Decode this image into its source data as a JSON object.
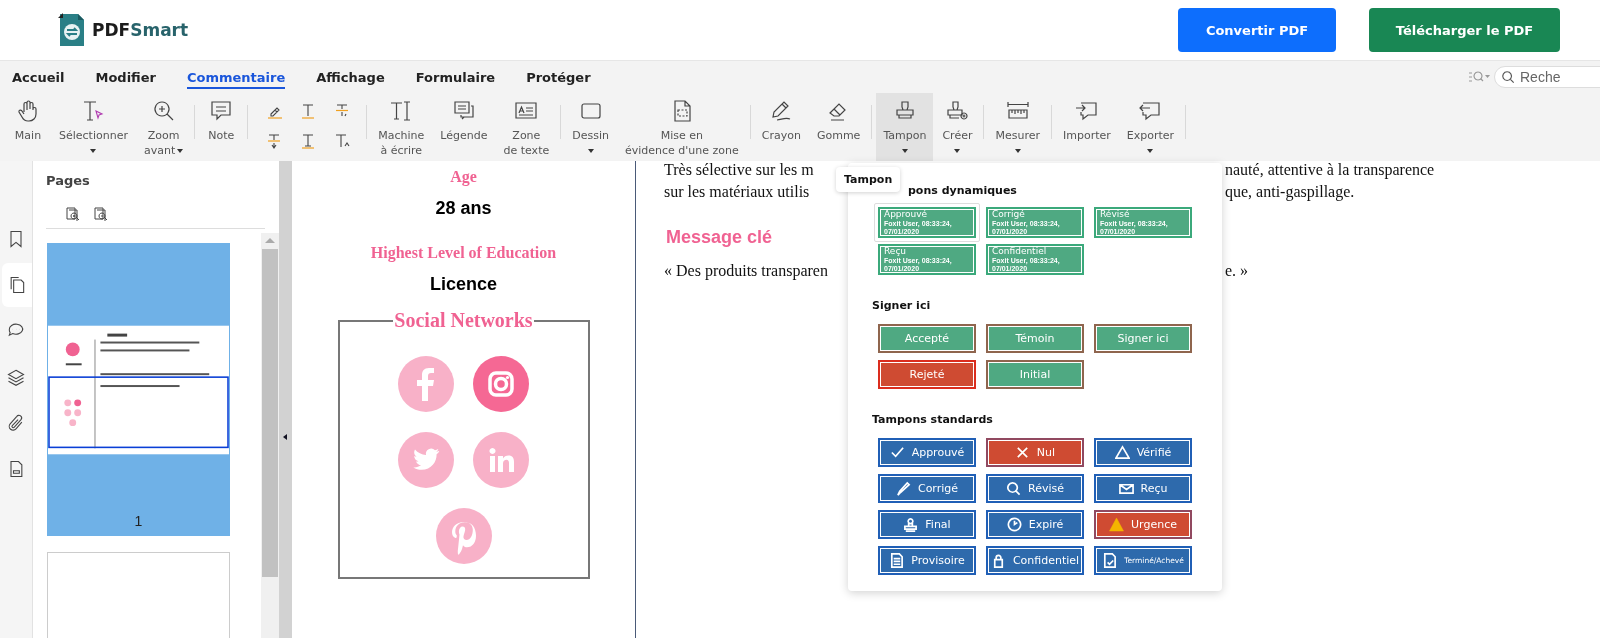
{
  "header": {
    "brand": [
      "PDF",
      "Smart"
    ],
    "buttons": [
      {
        "label": "Convertir PDF",
        "kind": "primary"
      },
      {
        "label": "Télécharger le PDF",
        "kind": "success"
      }
    ]
  },
  "menu_tabs": [
    {
      "label": "Accueil",
      "selected": false
    },
    {
      "label": "Modifier",
      "selected": false
    },
    {
      "label": "Commentaire",
      "selected": true
    },
    {
      "label": "Affichage",
      "selected": false
    },
    {
      "label": "Formulaire",
      "selected": false
    },
    {
      "label": "Protéger",
      "selected": false
    }
  ],
  "search": {
    "placeholder": "Reche"
  },
  "toolbar": {
    "groups": [
      {
        "kind": "tools",
        "tools": [
          {
            "lines": [
              "Main"
            ],
            "dropdown": false,
            "selected": false
          },
          {
            "lines": [
              "Sélectionner"
            ],
            "dropdown": true,
            "selected": false
          },
          {
            "lines": [
              "Zoom",
              "avant"
            ],
            "dropdown": true,
            "selected": false
          }
        ]
      },
      {
        "kind": "tools",
        "tools": [
          {
            "lines": [
              "Note"
            ],
            "dropdown": false,
            "selected": false
          }
        ]
      },
      {
        "kind": "markup"
      },
      {
        "kind": "tools",
        "tools": [
          {
            "lines": [
              "Machine",
              "à écrire"
            ],
            "dropdown": false,
            "selected": false
          },
          {
            "lines": [
              "Légende"
            ],
            "dropdown": false,
            "selected": false
          },
          {
            "lines": [
              "Zone",
              "de texte"
            ],
            "dropdown": false,
            "selected": false
          }
        ]
      },
      {
        "kind": "tools",
        "tools": [
          {
            "lines": [
              "Dessin"
            ],
            "dropdown": true,
            "selected": false
          },
          {
            "lines": [
              "Mise en",
              "évidence d'une zone"
            ],
            "dropdown": false,
            "selected": false
          }
        ]
      },
      {
        "kind": "tools",
        "tools": [
          {
            "lines": [
              "Crayon"
            ],
            "dropdown": false,
            "selected": false
          },
          {
            "lines": [
              "Gomme"
            ],
            "dropdown": false,
            "selected": false
          }
        ]
      },
      {
        "kind": "tools",
        "tools": [
          {
            "lines": [
              "Tampon"
            ],
            "dropdown": true,
            "selected": true
          },
          {
            "lines": [
              "Créer"
            ],
            "dropdown": true,
            "selected": false
          }
        ]
      },
      {
        "kind": "tools",
        "tools": [
          {
            "lines": [
              "Mesurer"
            ],
            "dropdown": true,
            "selected": false
          }
        ]
      },
      {
        "kind": "tools",
        "tools": [
          {
            "lines": [
              "Importer"
            ],
            "dropdown": false,
            "selected": false
          },
          {
            "lines": [
              "Exporter"
            ],
            "dropdown": true,
            "selected": false
          }
        ]
      }
    ]
  },
  "tooltip": "Tampon",
  "rail": [
    {
      "selected": false
    },
    {
      "selected": true
    },
    {
      "selected": false
    },
    {
      "selected": false
    },
    {
      "selected": false
    },
    {
      "selected": false
    }
  ],
  "pages_panel": {
    "title": "Pages",
    "thumbnails": [
      {
        "page_number": "1",
        "selected": true
      },
      {
        "selected": false
      }
    ]
  },
  "document": {
    "fields": [
      {
        "label": "Age",
        "value": "28 ans"
      },
      {
        "label": "Highest Level of Education",
        "value": "Licence"
      }
    ],
    "social": {
      "title": "Social Networks",
      "icons": [
        {
          "active": false
        },
        {
          "active": true
        },
        {
          "active": false
        },
        {
          "active": false
        },
        {
          "active": false
        }
      ]
    }
  },
  "right_pane": [
    {
      "kind": "text",
      "lines": [
        {
          "left": "Très sélective sur les m",
          "right": "nauté, attentive à la transparence"
        },
        {
          "left": "sur les matériaux utilis",
          "right": "que, anti-gaspillage."
        }
      ]
    },
    {
      "kind": "heading",
      "text": "Message clé"
    },
    {
      "kind": "text",
      "lines": [
        {
          "left": "« Des produits transparen",
          "right": "e. »"
        }
      ]
    }
  ],
  "stamp_menu": {
    "sections": [
      {
        "title": "pons dynamiques",
        "kind": "dynamic",
        "stamps": [
          {
            "label": "Approuvé",
            "detail": "Foxit User, 08:33:24, 07/01/2020",
            "color": "#4fa982",
            "selected": true
          },
          {
            "label": "Corrigé",
            "detail": "Foxit User, 08:33:24, 07/01/2020",
            "color": "#4fa982",
            "selected": false
          },
          {
            "label": "Révisé",
            "detail": "Foxit User, 08:33:24, 07/01/2020",
            "color": "#4fa982",
            "selected": false
          },
          {
            "label": "Reçu",
            "detail": "Foxit User, 08:33:24, 07/01/2020",
            "color": "#4fa982",
            "selected": false
          },
          {
            "label": "Confidentiel",
            "detail": "Foxit User, 08:33:24, 07/01/2020",
            "color": "#4fa982",
            "selected": false
          }
        ]
      },
      {
        "title": "Signer ici",
        "kind": "sign",
        "stamps": [
          {
            "label": "Accepté",
            "color": "#4fa982"
          },
          {
            "label": "Témoin",
            "color": "#4fa982"
          },
          {
            "label": "Signer ici",
            "color": "#4fa982"
          },
          {
            "label": "Rejeté",
            "color": "#cf4b32"
          },
          {
            "label": "Initial",
            "color": "#4fa982"
          }
        ]
      },
      {
        "title": "Tampons standards",
        "kind": "standard",
        "stamps": [
          {
            "label": "Approuvé",
            "color": "#2e6aac"
          },
          {
            "label": "Nul",
            "color": "#cf4b32"
          },
          {
            "label": "Vérifié",
            "color": "#2e6aac"
          },
          {
            "label": "Corrigé",
            "color": "#2e6aac"
          },
          {
            "label": "Révisé",
            "color": "#2e6aac"
          },
          {
            "label": "Reçu",
            "color": "#2e6aac"
          },
          {
            "label": "Final",
            "color": "#2e6aac"
          },
          {
            "label": "Expiré",
            "color": "#2e6aac"
          },
          {
            "label": "Urgence",
            "color": "#cf4b32"
          },
          {
            "label": "Provisoire",
            "color": "#2e6aac"
          },
          {
            "label": "Confidentiel",
            "color": "#2e6aac"
          },
          {
            "label": "Terminé/Achevé",
            "color": "#2e6aac",
            "small": true
          }
        ]
      }
    ]
  }
}
